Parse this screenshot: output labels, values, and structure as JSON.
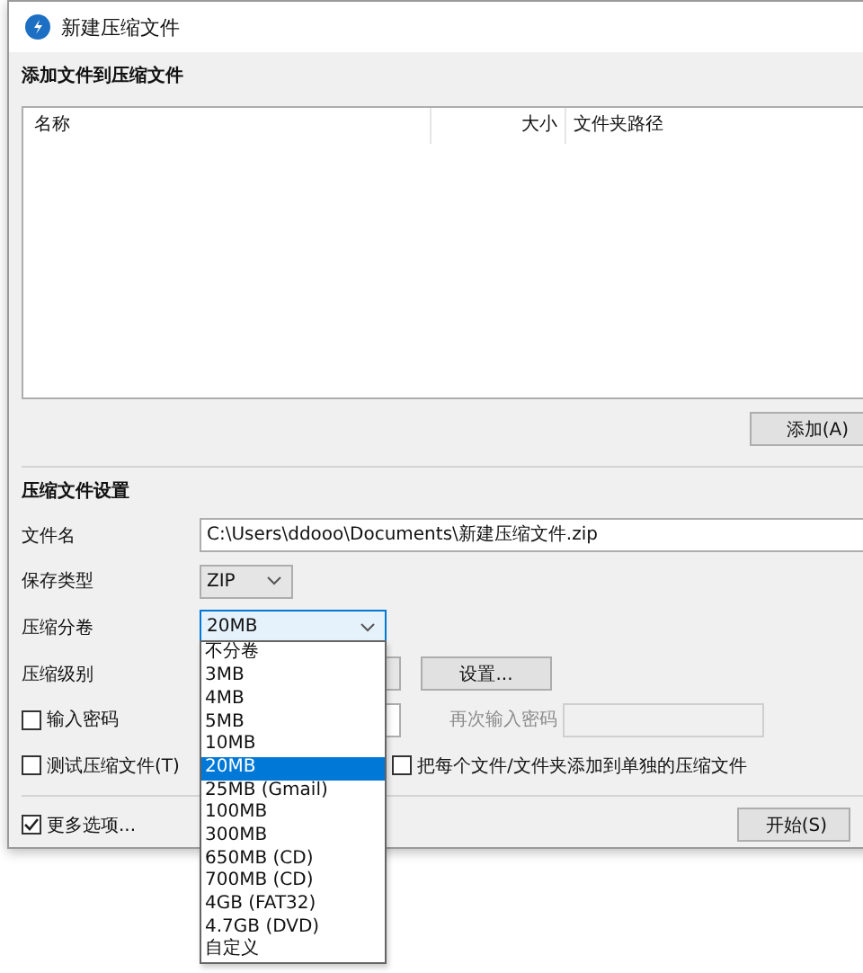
{
  "window": {
    "title": "新建压缩文件"
  },
  "add_section": {
    "heading": "添加文件到压缩文件",
    "columns": [
      "名称",
      "大小",
      "文件夹路径"
    ],
    "add_button": "添加(A)"
  },
  "settings": {
    "heading": "压缩文件设置",
    "filename": {
      "label": "文件名",
      "value": "C:\\Users\\ddooo\\Documents\\新建压缩文件.zip"
    },
    "type": {
      "label": "保存类型",
      "value": "ZIP"
    },
    "split": {
      "label": "压缩分卷",
      "value": "20MB",
      "expanded": true,
      "options": [
        {
          "label": "不分卷",
          "selected": false
        },
        {
          "label": "3MB",
          "selected": false
        },
        {
          "label": "4MB",
          "selected": false
        },
        {
          "label": "5MB",
          "selected": false
        },
        {
          "label": "10MB",
          "selected": false
        },
        {
          "label": "20MB",
          "selected": true
        },
        {
          "label": "25MB (Gmail)",
          "selected": false
        },
        {
          "label": "100MB",
          "selected": false
        },
        {
          "label": "300MB",
          "selected": false
        },
        {
          "label": "650MB (CD)",
          "selected": false
        },
        {
          "label": "700MB (CD)",
          "selected": false
        },
        {
          "label": "4GB (FAT32)",
          "selected": false
        },
        {
          "label": "4.7GB (DVD)",
          "selected": false
        },
        {
          "label": "自定义",
          "selected": false
        }
      ]
    },
    "level": {
      "label": "压缩级别",
      "button": "设置..."
    },
    "password": {
      "label": "输入密码",
      "checked": false,
      "repeat_label": "再次输入密码"
    },
    "test": {
      "label": "测试压缩文件(T)",
      "checked": false
    },
    "separate": {
      "label": "把每个文件/文件夹添加到单独的压缩文件",
      "checked": false
    }
  },
  "footer": {
    "more_options": {
      "label": "更多选项...",
      "checked": true
    },
    "start_button": "开始(S)"
  }
}
